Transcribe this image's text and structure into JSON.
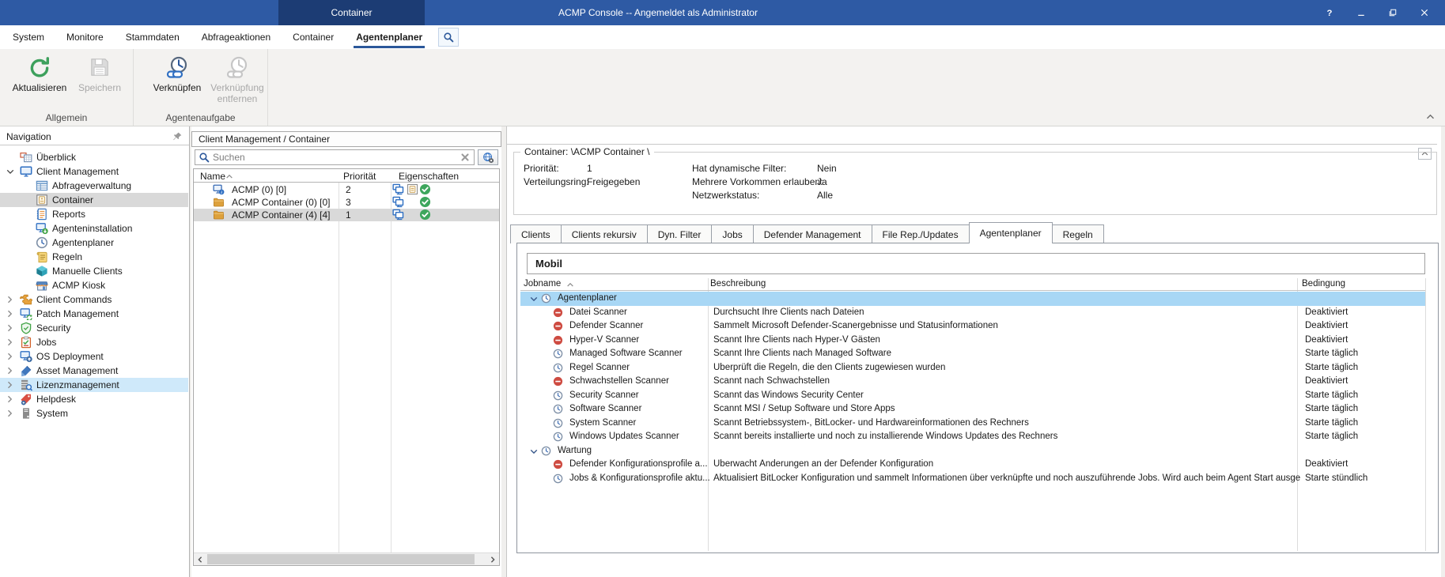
{
  "window": {
    "title": "ACMP Console -- Angemeldet als Administrator",
    "context_tab": "Container"
  },
  "menubar": {
    "items": [
      {
        "label": "System",
        "active": false
      },
      {
        "label": "Monitore",
        "active": false
      },
      {
        "label": "Stammdaten",
        "active": false
      },
      {
        "label": "Abfrageaktionen",
        "active": false
      },
      {
        "label": "Container",
        "active": false
      },
      {
        "label": "Agentenplaner",
        "active": true
      }
    ]
  },
  "ribbon": {
    "groups": [
      {
        "label": "Allgemein",
        "buttons": [
          {
            "label": "Aktualisieren",
            "icon": "refresh",
            "enabled": true
          },
          {
            "label": "Speichern",
            "icon": "save",
            "enabled": false
          }
        ]
      },
      {
        "label": "Agentenaufgabe",
        "buttons": [
          {
            "label": "Verknüpfen",
            "icon": "link-clock",
            "enabled": true
          },
          {
            "label": "Verknüpfung entfernen",
            "icon": "unlink-clock",
            "enabled": false
          }
        ]
      }
    ]
  },
  "sidebar": {
    "header": "Navigation",
    "items": [
      {
        "label": "Überblick",
        "icon": "overview",
        "level": 0,
        "chevron": null
      },
      {
        "label": "Client Management",
        "icon": "client-management",
        "level": 0,
        "chevron": "down"
      },
      {
        "label": "Abfrageverwaltung",
        "icon": "query-management",
        "level": 1,
        "chevron": null
      },
      {
        "label": "Container",
        "icon": "container",
        "level": 1,
        "chevron": null,
        "selected": true
      },
      {
        "label": "Reports",
        "icon": "reports",
        "level": 1,
        "chevron": null
      },
      {
        "label": "Agenteninstallation",
        "icon": "agent-installation",
        "level": 1,
        "chevron": null
      },
      {
        "label": "Agentenplaner",
        "icon": "agent-scheduler",
        "level": 1,
        "chevron": null
      },
      {
        "label": "Regeln",
        "icon": "rules",
        "level": 1,
        "chevron": null
      },
      {
        "label": "Manuelle Clients",
        "icon": "manual-clients",
        "level": 1,
        "chevron": null
      },
      {
        "label": "ACMP Kiosk",
        "icon": "kiosk",
        "level": 1,
        "chevron": null
      },
      {
        "label": "Client Commands",
        "icon": "client-commands",
        "level": 0,
        "chevron": "right"
      },
      {
        "label": "Patch Management",
        "icon": "patch-management",
        "level": 0,
        "chevron": "right"
      },
      {
        "label": "Security",
        "icon": "security",
        "level": 0,
        "chevron": "right"
      },
      {
        "label": "Jobs",
        "icon": "jobs",
        "level": 0,
        "chevron": "right"
      },
      {
        "label": "OS Deployment",
        "icon": "os-deployment",
        "level": 0,
        "chevron": "right"
      },
      {
        "label": "Asset Management",
        "icon": "asset-management",
        "level": 0,
        "chevron": "right"
      },
      {
        "label": "Lizenzmanagement",
        "icon": "license-management",
        "level": 0,
        "chevron": "right",
        "highlighted": true
      },
      {
        "label": "Helpdesk",
        "icon": "helpdesk",
        "level": 0,
        "chevron": "right"
      },
      {
        "label": "System",
        "icon": "system",
        "level": 0,
        "chevron": "right"
      }
    ]
  },
  "breadcrumb": "Client Management / Container",
  "container_list": {
    "search_placeholder": "Suchen",
    "columns": [
      "Name",
      "Priorität",
      "Eigenschaften"
    ],
    "rows": [
      {
        "name": "ACMP (0) [0]",
        "icon": "computer-info",
        "priority": "2",
        "props": [
          "monitors",
          "container-prop",
          "check"
        ],
        "selected": false
      },
      {
        "name": "ACMP Container (0) [0]",
        "icon": "folder",
        "priority": "3",
        "props": [
          "monitors",
          "",
          "check"
        ],
        "selected": false
      },
      {
        "name": "ACMP Container (4) [4]",
        "icon": "folder",
        "priority": "1",
        "props": [
          "monitors",
          "",
          "check"
        ],
        "selected": true
      }
    ]
  },
  "details": {
    "legend": "Container: \\ACMP Container \\",
    "fields_left": [
      {
        "label": "Priorität:",
        "value": "1"
      },
      {
        "label": "Verteilungsring:",
        "value": "Freigegeben"
      }
    ],
    "fields_right": [
      {
        "label": "Hat dynamische Filter:",
        "value": "Nein"
      },
      {
        "label": "Mehrere Vorkommen erlauben:",
        "value": "Ja"
      },
      {
        "label": "Netzwerkstatus:",
        "value": "Alle"
      }
    ]
  },
  "tabs": [
    {
      "label": "Clients",
      "active": false
    },
    {
      "label": "Clients rekursiv",
      "active": false
    },
    {
      "label": "Dyn. Filter",
      "active": false
    },
    {
      "label": "Jobs",
      "active": false
    },
    {
      "label": "Defender Management",
      "active": false
    },
    {
      "label": "File Rep./Updates",
      "active": false
    },
    {
      "label": "Agentenplaner",
      "active": true
    },
    {
      "label": "Regeln",
      "active": false
    }
  ],
  "scheduler": {
    "group_title": "Mobil",
    "columns": [
      "Jobname",
      "Beschreibung",
      "Bedingung"
    ],
    "rows": [
      {
        "type": "group",
        "label": "Agentenplaner",
        "icon": "clock",
        "highlighted": true
      },
      {
        "type": "job",
        "label": "Datei Scanner",
        "icon": "deactivated",
        "description": "Durchsucht Ihre Clients nach Dateien",
        "condition": "Deaktiviert"
      },
      {
        "type": "job",
        "label": "Defender Scanner",
        "icon": "deactivated",
        "description": "Sammelt Microsoft Defender-Scanergebnisse und Statusinformationen",
        "condition": "Deaktiviert"
      },
      {
        "type": "job",
        "label": "Hyper-V Scanner",
        "icon": "deactivated",
        "description": "Scannt Ihre Clients nach Hyper-V Gästen",
        "condition": "Deaktiviert"
      },
      {
        "type": "job",
        "label": "Managed Software Scanner",
        "icon": "clock",
        "description": "Scannt Ihre Clients nach Managed Software",
        "condition": "Starte täglich"
      },
      {
        "type": "job",
        "label": "Regel Scanner",
        "icon": "clock",
        "description": "Überprüft die Regeln, die den Clients zugewiesen wurden",
        "condition": "Starte täglich"
      },
      {
        "type": "job",
        "label": "Schwachstellen Scanner",
        "icon": "deactivated",
        "description": "Scannt nach Schwachstellen",
        "condition": "Deaktiviert"
      },
      {
        "type": "job",
        "label": "Security Scanner",
        "icon": "clock",
        "description": "Scannt das Windows Security Center",
        "condition": "Starte täglich"
      },
      {
        "type": "job",
        "label": "Software Scanner",
        "icon": "clock",
        "description": "Scannt MSI / Setup Software und Store Apps",
        "condition": "Starte täglich"
      },
      {
        "type": "job",
        "label": "System Scanner",
        "icon": "clock",
        "description": "Scannt Betriebssystem-, BitLocker- und Hardwareinformationen des Rechners",
        "condition": "Starte täglich"
      },
      {
        "type": "job",
        "label": "Windows Updates Scanner",
        "icon": "clock",
        "description": "Scannt bereits installierte und noch zu installierende Windows Updates des Rechners",
        "condition": "Starte täglich"
      },
      {
        "type": "group",
        "label": "Wartung",
        "icon": "clock",
        "highlighted": false
      },
      {
        "type": "job",
        "label": "Defender Konfigurationsprofile a...",
        "icon": "deactivated",
        "description": "Überwacht Änderungen an der Defender Konfiguration",
        "condition": "Deaktiviert"
      },
      {
        "type": "job",
        "label": "Jobs & Konfigurationsprofile aktu...",
        "icon": "clock",
        "description": "Aktualisiert BitLocker Konfiguration und sammelt Informationen über verknüpfte und noch auszuführende Jobs. Wird auch beim Agent Start ausgeführt.",
        "condition": "Starte stündlich"
      }
    ]
  },
  "colors": {
    "titlebar": "#2e5aa4",
    "titlebar-tab": "#1c3c74",
    "accent": "#2b579a",
    "selected-row": "#d9d9d9",
    "hover-row": "#cfe9fa",
    "group-row": "#a8d7f5",
    "refresh-green": "#3da05c",
    "check-green": "#3da65c",
    "disabled-red": "#ce4b41"
  }
}
